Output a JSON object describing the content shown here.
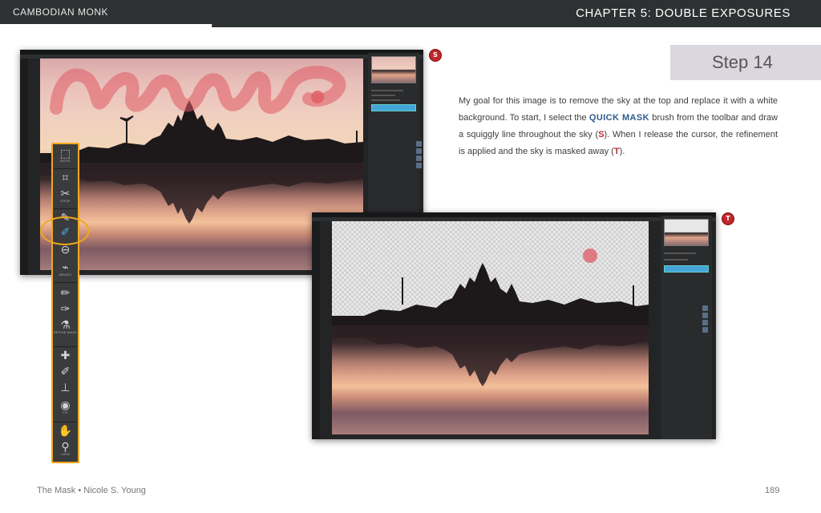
{
  "header": {
    "left_title": "CAMBODIAN MONK",
    "chapter_title": "CHAPTER 5: DOUBLE EXPOSURES"
  },
  "step": {
    "label": "Step 14"
  },
  "body": {
    "part1": "My goal for this image is to remove the sky at the top and replace it with a white background. To start, I select the ",
    "quick_mask": "QUICK MASK",
    "part2": " brush from the toolbar and draw a squiggly line throughout the sky (",
    "badge_s": "S",
    "part3": "). When I release the cursor, the refinement is applied and the sky is masked away (",
    "badge_t": "T",
    "part4": ")."
  },
  "badges": {
    "s": "S",
    "t": "T"
  },
  "toolbar": {
    "move_label": "MOVE",
    "crop_label": "CROP",
    "brush_label": "BRUSH",
    "refine_mask_label": "REFINE MASK",
    "fix_label": "FIX",
    "view_label": "VIEW"
  },
  "footer": {
    "book": "The Mask • Nicole S. Young",
    "page_number": "189"
  },
  "colors": {
    "header_bg": "#2d3132",
    "step_bg": "#dcd7df",
    "accent_orange": "#f0a81e",
    "badge_red": "#c0272d",
    "quick_mask_blue": "#2f5c8f"
  }
}
